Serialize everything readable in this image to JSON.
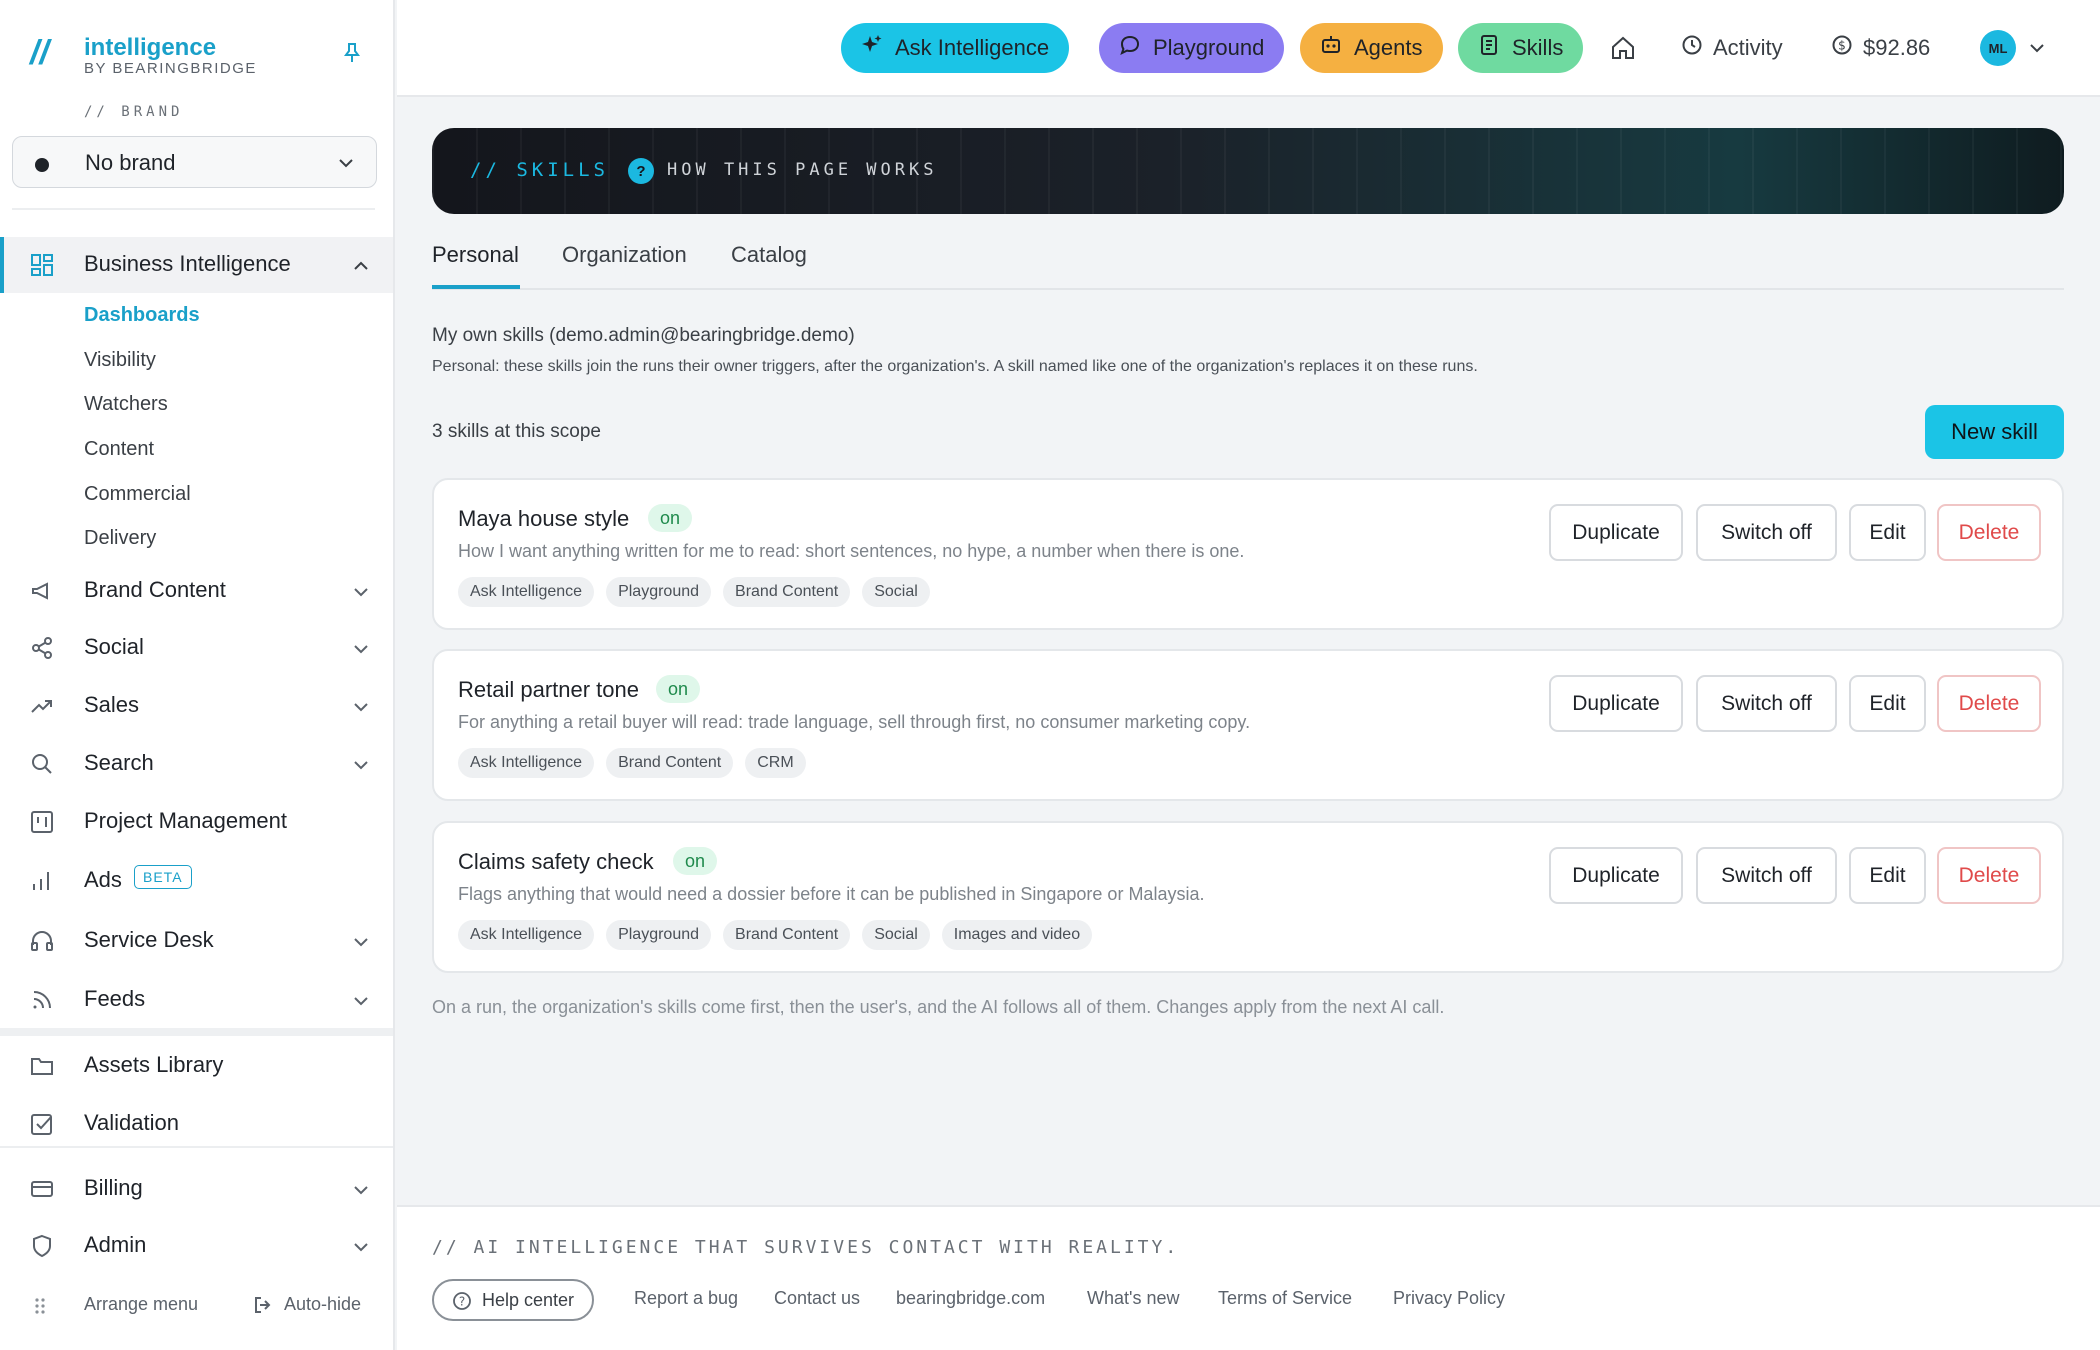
{
  "brand": {
    "logo_mark": "//",
    "name": "intelligence",
    "sub": "BY BEARINGBRIDGE",
    "section_label": "// BRAND",
    "select_value": "No brand"
  },
  "sidebar": {
    "bi": {
      "label": "Business Intelligence",
      "sub": [
        "Dashboards",
        "Visibility",
        "Watchers",
        "Content",
        "Commercial",
        "Delivery"
      ]
    },
    "items": [
      {
        "label": "Brand Content"
      },
      {
        "label": "Social"
      },
      {
        "label": "Sales"
      },
      {
        "label": "Search"
      },
      {
        "label": "Project Management"
      },
      {
        "label": "Ads",
        "badge": "BETA"
      },
      {
        "label": "Service Desk"
      },
      {
        "label": "Feeds"
      },
      {
        "label": "Assets Library"
      },
      {
        "label": "Validation"
      },
      {
        "label": "Billing"
      },
      {
        "label": "Admin"
      }
    ],
    "arrange": "Arrange menu",
    "autohide": "Auto-hide"
  },
  "topbar": {
    "ask": "Ask Intelligence",
    "playground": "Playground",
    "agents": "Agents",
    "skills": "Skills",
    "activity": "Activity",
    "balance": "$92.86",
    "avatar": "ML",
    "colors": {
      "ask": "#1bc4e6",
      "playground": "#8b7cf2",
      "agents": "#f5b041",
      "skills": "#6fdaa0"
    }
  },
  "banner": {
    "title": "// SKILLS",
    "how": "HOW THIS PAGE WORKS",
    "q": "?"
  },
  "tabs": [
    "Personal",
    "Organization",
    "Catalog"
  ],
  "main": {
    "owner": "My own skills (demo.admin@bearingbridge.demo)",
    "desc": "Personal: these skills join the runs their owner triggers, after the organization's. A skill named like one of the organization's replaces it on these runs.",
    "count": "3 skills at this scope",
    "new_skill": "New skill",
    "note": "On a run, the organization's skills come first, then the user's, and the AI follows all of them. Changes apply from the next AI call."
  },
  "actions": {
    "duplicate": "Duplicate",
    "switch_off": "Switch off",
    "edit": "Edit",
    "delete": "Delete"
  },
  "skills": [
    {
      "title": "Maya house style",
      "status": "on",
      "desc": "How I want anything written for me to read: short sentences, no hype, a number when there is one.",
      "tags": [
        "Ask Intelligence",
        "Playground",
        "Brand Content",
        "Social"
      ]
    },
    {
      "title": "Retail partner tone",
      "status": "on",
      "desc": "For anything a retail buyer will read: trade language, sell through first, no consumer marketing copy.",
      "tags": [
        "Ask Intelligence",
        "Brand Content",
        "CRM"
      ]
    },
    {
      "title": "Claims safety check",
      "status": "on",
      "desc": "Flags anything that would need a dossier before it can be published in Singapore or Malaysia.",
      "tags": [
        "Ask Intelligence",
        "Playground",
        "Brand Content",
        "Social",
        "Images and video"
      ]
    }
  ],
  "footer": {
    "tagline": "// AI INTELLIGENCE THAT SURVIVES CONTACT WITH REALITY.",
    "help": "Help center",
    "links": [
      "Report a bug",
      "Contact us",
      "bearingbridge.com",
      "What's new",
      "Terms of Service",
      "Privacy Policy"
    ]
  }
}
